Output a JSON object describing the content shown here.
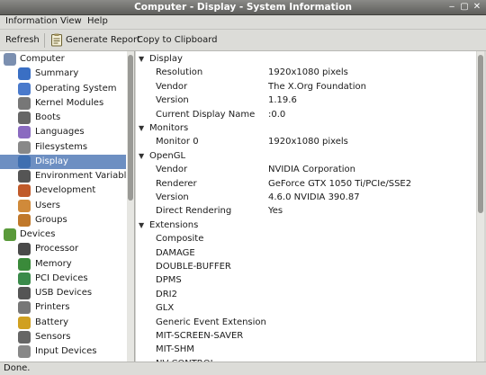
{
  "window": {
    "title": "Computer - Display - System Information"
  },
  "menu": {
    "information": "Information",
    "view": "View",
    "help": "Help"
  },
  "toolbar": {
    "refresh": "Refresh",
    "generate_report": "Generate Report",
    "copy_clipboard": "Copy to Clipboard"
  },
  "sidebar": {
    "items": [
      {
        "label": "Computer",
        "icon": "computer-icon",
        "color": "#7b8fb0",
        "type": "cat"
      },
      {
        "label": "Summary",
        "icon": "info-icon",
        "color": "#3a6fc4",
        "type": "sub"
      },
      {
        "label": "Operating System",
        "icon": "os-icon",
        "color": "#4a7acc",
        "type": "sub"
      },
      {
        "label": "Kernel Modules",
        "icon": "module-icon",
        "color": "#777777",
        "type": "sub"
      },
      {
        "label": "Boots",
        "icon": "power-icon",
        "color": "#666666",
        "type": "sub"
      },
      {
        "label": "Languages",
        "icon": "languages-icon",
        "color": "#8a6ac0",
        "type": "sub"
      },
      {
        "label": "Filesystems",
        "icon": "filesystem-icon",
        "color": "#888888",
        "type": "sub"
      },
      {
        "label": "Display",
        "icon": "display-icon",
        "color": "#3f6fb0",
        "type": "sub",
        "selected": true
      },
      {
        "label": "Environment Variables",
        "icon": "env-icon",
        "color": "#555555",
        "type": "sub"
      },
      {
        "label": "Development",
        "icon": "development-icon",
        "color": "#c05a2a",
        "type": "sub"
      },
      {
        "label": "Users",
        "icon": "users-icon",
        "color": "#d08a3a",
        "type": "sub"
      },
      {
        "label": "Groups",
        "icon": "groups-icon",
        "color": "#c0782a",
        "type": "sub"
      },
      {
        "label": "Devices",
        "icon": "devices-icon",
        "color": "#5a9a3a",
        "type": "cat"
      },
      {
        "label": "Processor",
        "icon": "processor-icon",
        "color": "#4a4a4a",
        "type": "sub"
      },
      {
        "label": "Memory",
        "icon": "memory-icon",
        "color": "#3a8a3a",
        "type": "sub"
      },
      {
        "label": "PCI Devices",
        "icon": "pci-icon",
        "color": "#3a8a4a",
        "type": "sub"
      },
      {
        "label": "USB Devices",
        "icon": "usb-icon",
        "color": "#555555",
        "type": "sub"
      },
      {
        "label": "Printers",
        "icon": "printer-icon",
        "color": "#777777",
        "type": "sub"
      },
      {
        "label": "Battery",
        "icon": "battery-icon",
        "color": "#d0a020",
        "type": "sub"
      },
      {
        "label": "Sensors",
        "icon": "sensors-icon",
        "color": "#666666",
        "type": "sub"
      },
      {
        "label": "Input Devices",
        "icon": "input-icon",
        "color": "#888888",
        "type": "sub"
      }
    ]
  },
  "content": {
    "rows": [
      {
        "type": "section",
        "label": "Display"
      },
      {
        "type": "kv",
        "key": "Resolution",
        "value": "1920x1080 pixels"
      },
      {
        "type": "kv",
        "key": "Vendor",
        "value": "The X.Org Foundation"
      },
      {
        "type": "kv",
        "key": "Version",
        "value": "1.19.6"
      },
      {
        "type": "kv",
        "key": "Current Display Name",
        "value": ":0.0"
      },
      {
        "type": "section",
        "label": "Monitors"
      },
      {
        "type": "kv",
        "key": "Monitor 0",
        "value": "1920x1080 pixels"
      },
      {
        "type": "section",
        "label": "OpenGL"
      },
      {
        "type": "kv",
        "key": "Vendor",
        "value": "NVIDIA Corporation"
      },
      {
        "type": "kv",
        "key": "Renderer",
        "value": "GeForce GTX 1050 Ti/PCIe/SSE2"
      },
      {
        "type": "kv",
        "key": "Version",
        "value": "4.6.0 NVIDIA 390.87"
      },
      {
        "type": "kv",
        "key": "Direct Rendering",
        "value": "Yes"
      },
      {
        "type": "section",
        "label": "Extensions"
      },
      {
        "type": "kv",
        "key": "Composite",
        "value": ""
      },
      {
        "type": "kv",
        "key": "DAMAGE",
        "value": ""
      },
      {
        "type": "kv",
        "key": "DOUBLE-BUFFER",
        "value": ""
      },
      {
        "type": "kv",
        "key": "DPMS",
        "value": ""
      },
      {
        "type": "kv",
        "key": "DRI2",
        "value": ""
      },
      {
        "type": "kv",
        "key": "GLX",
        "value": ""
      },
      {
        "type": "kv",
        "key": "Generic Event Extension",
        "value": ""
      },
      {
        "type": "kv",
        "key": "MIT-SCREEN-SAVER",
        "value": ""
      },
      {
        "type": "kv",
        "key": "MIT-SHM",
        "value": ""
      },
      {
        "type": "kv",
        "key": "NV-CONTROL",
        "value": ""
      }
    ]
  },
  "status": {
    "text": "Done."
  },
  "colors": {
    "selection": "#6d8fc2",
    "titlebar": "#6a6a67"
  }
}
